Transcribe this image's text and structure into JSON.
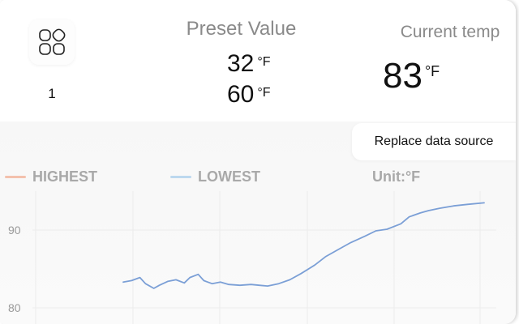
{
  "header": {
    "mode_number": "1",
    "preset_title": "Preset Value",
    "preset_values": [
      {
        "value": "32",
        "unit": "°F"
      },
      {
        "value": "60",
        "unit": "°F"
      }
    ],
    "current_title": "Current temp",
    "current_value": "83",
    "current_unit": "°F"
  },
  "controls": {
    "replace_label": "Replace data source"
  },
  "chart_data": {
    "type": "line",
    "legend": [
      {
        "label": "HIGHEST",
        "color": "#f3c1ad"
      },
      {
        "label": "LOWEST",
        "color": "#bcd8ef"
      }
    ],
    "unit_label": "Unit:°F",
    "y_ticks": [
      "90",
      "80"
    ],
    "series": [
      {
        "color": "#7b9fd6",
        "x": [
          0,
          3,
          6,
          8,
          11,
          13,
          16,
          19,
          22,
          24,
          27,
          29,
          32,
          35,
          38,
          42,
          46,
          49,
          52,
          56,
          60,
          64,
          69,
          73,
          78,
          82,
          87,
          91,
          95,
          100,
          103,
          107,
          110,
          114,
          119,
          124,
          130
        ],
        "y": [
          83.3,
          83.5,
          83.9,
          83.1,
          82.5,
          82.9,
          83.4,
          83.6,
          83.2,
          83.9,
          84.3,
          83.5,
          83.1,
          83.3,
          83.0,
          82.9,
          83.0,
          82.9,
          82.8,
          83.1,
          83.6,
          84.4,
          85.5,
          86.6,
          87.6,
          88.4,
          89.2,
          89.9,
          90.1,
          90.8,
          91.7,
          92.2,
          92.5,
          92.8,
          93.1,
          93.3,
          93.5
        ]
      }
    ]
  }
}
